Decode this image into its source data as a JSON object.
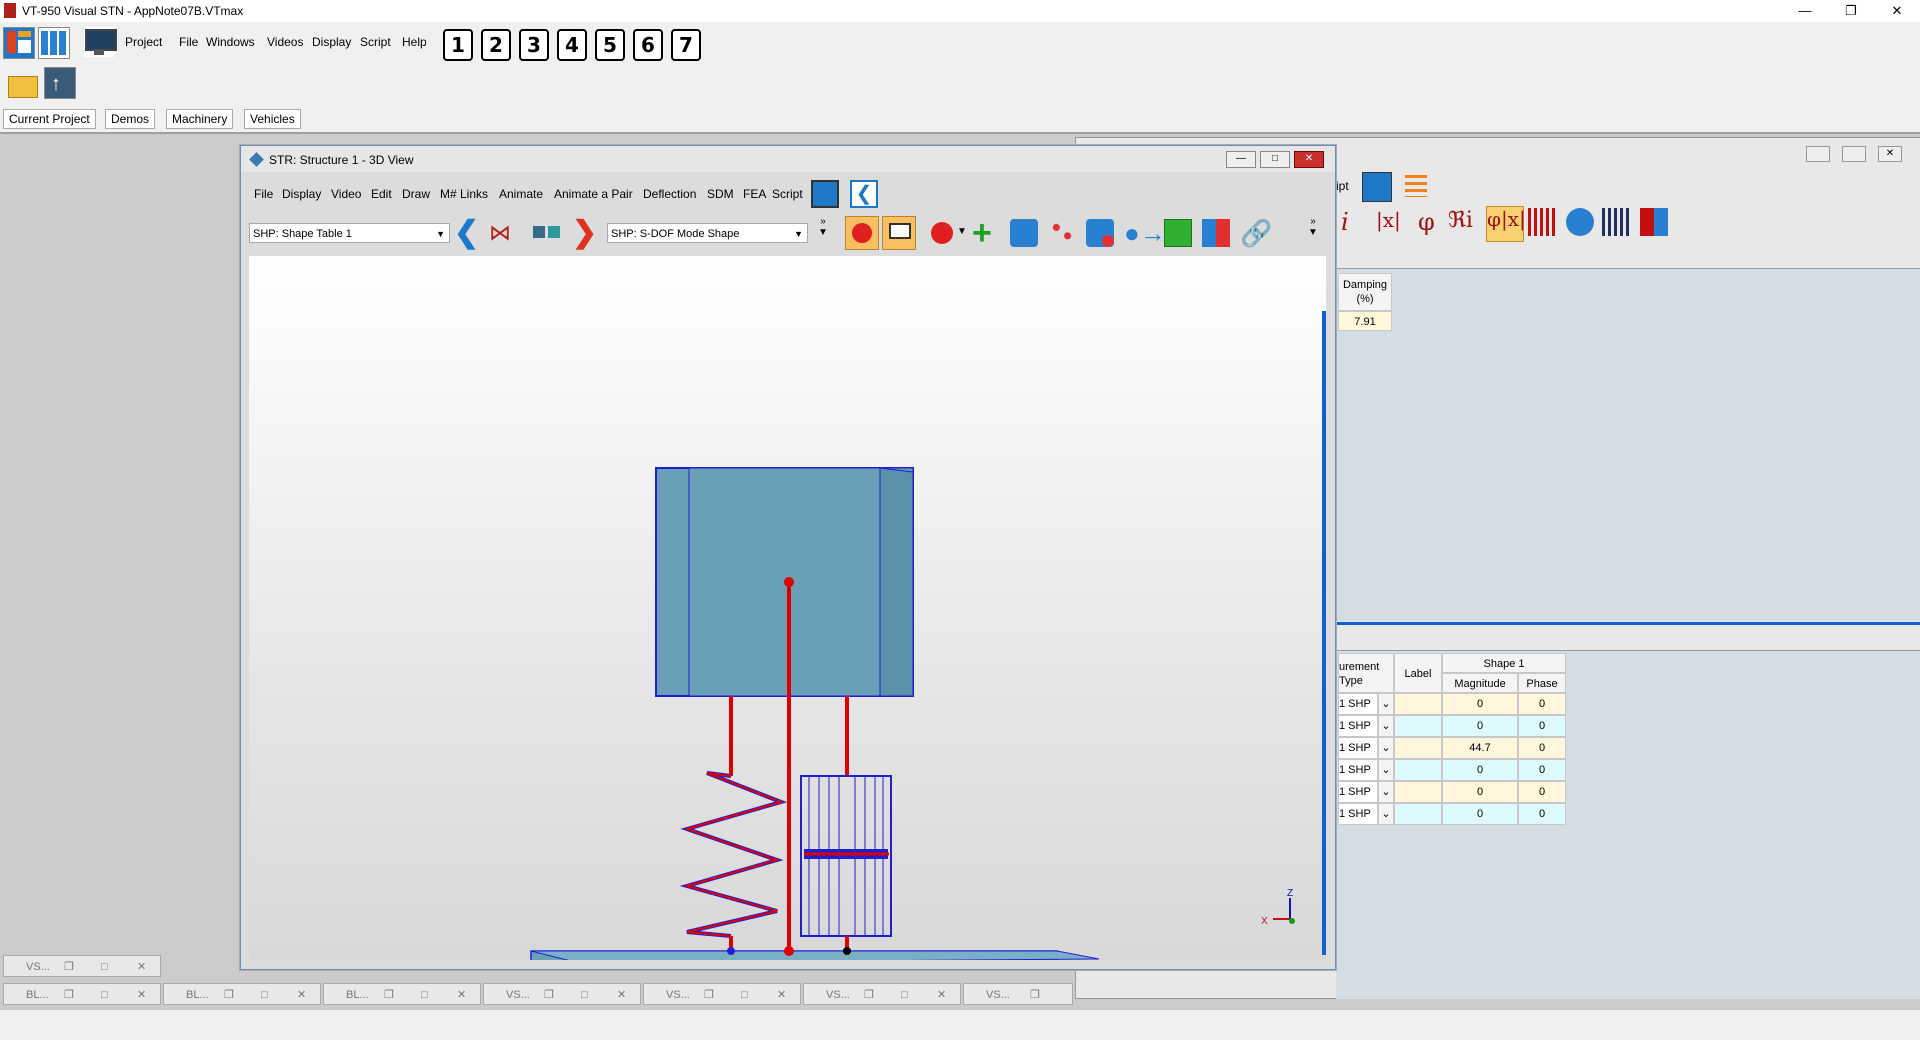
{
  "app": {
    "title": "VT-950 Visual STN - AppNote07B.VTmax"
  },
  "main_menu": [
    "Project",
    "File",
    "Windows",
    "Videos",
    "Display",
    "Script",
    "Help"
  ],
  "number_buttons": [
    "1",
    "2",
    "3",
    "4",
    "5",
    "6",
    "7"
  ],
  "project_tabs": [
    "Current Project",
    "Demos",
    "Machinery",
    "Vehicles"
  ],
  "str_window": {
    "title": "STR: Structure 1 - 3D View",
    "menu": [
      "File",
      "Display",
      "Video",
      "Edit",
      "Draw",
      "M# Links",
      "Animate",
      "Animate a Pair",
      "Deflection",
      "SDM",
      "FEA",
      "Script"
    ],
    "shape_table_select": "SHP: Shape Table 1",
    "mode_shape_select": "SHP: S-DOF Mode Shape",
    "axis_labels": {
      "z": "Z",
      "x": "X"
    }
  },
  "bg_window": {
    "menu_fragment": "ipt",
    "damping_header": "Damping (%)",
    "damping_value": "7.91",
    "table_headers": {
      "measurement_type": "urement Type",
      "label": "Label",
      "shape": "Shape 1",
      "magnitude": "Magnitude",
      "phase": "Phase"
    },
    "rows": [
      {
        "type": "1 SHP",
        "magnitude": "0",
        "phase": "0"
      },
      {
        "type": "1 SHP",
        "magnitude": "0",
        "phase": "0"
      },
      {
        "type": "1 SHP",
        "magnitude": "44.7",
        "phase": "0"
      },
      {
        "type": "1 SHP",
        "magnitude": "0",
        "phase": "0"
      },
      {
        "type": "1 SHP",
        "magnitude": "0",
        "phase": "0"
      },
      {
        "type": "1 SHP",
        "magnitude": "0",
        "phase": "0"
      }
    ]
  },
  "minimized": {
    "row1": [
      "VS..."
    ],
    "row2": [
      "BL...",
      "BL...",
      "BL...",
      "VS...",
      "VS...",
      "VS...",
      "VS..."
    ]
  }
}
